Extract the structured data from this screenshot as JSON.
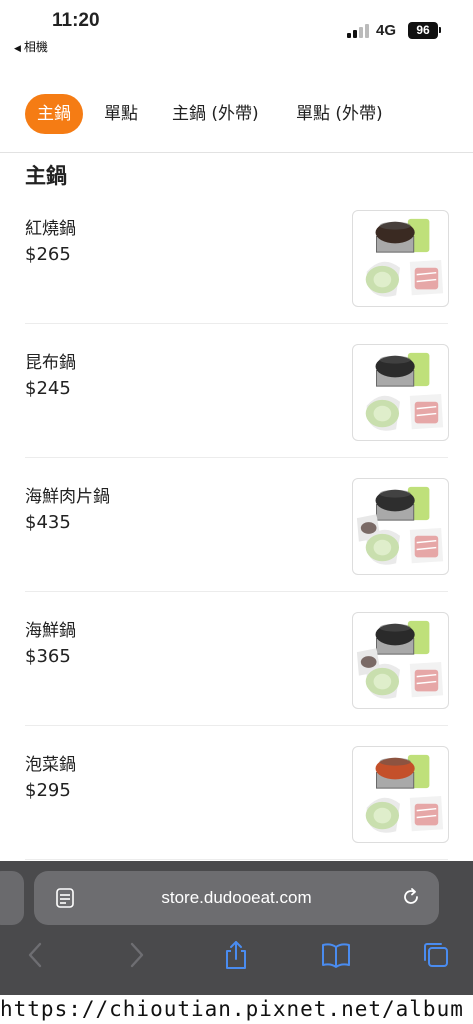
{
  "status_bar": {
    "time": "11:20",
    "back_app": "相機",
    "network": "4G",
    "battery": "96"
  },
  "tabs": [
    {
      "label": "主鍋",
      "active": true
    },
    {
      "label": "單點",
      "active": false
    },
    {
      "label": "主鍋 (外帶)",
      "active": false
    },
    {
      "label": "單點 (外帶)",
      "active": false
    }
  ],
  "section_title": "主鍋",
  "menu_items": [
    {
      "name": "紅燒鍋",
      "price": "$265",
      "broth_color": "#3a2a22"
    },
    {
      "name": "昆布鍋",
      "price": "$245",
      "broth_color": "#2b2b2b"
    },
    {
      "name": "海鮮肉片鍋",
      "price": "$435",
      "broth_color": "#2e2e2e"
    },
    {
      "name": "海鮮鍋",
      "price": "$365",
      "broth_color": "#2a2a2a"
    },
    {
      "name": "泡菜鍋",
      "price": "$295",
      "broth_color": "#c4502a"
    }
  ],
  "browser": {
    "url": "store.dudooeat.com",
    "icons": [
      "reader-icon",
      "reload-icon",
      "back-arrow-icon",
      "forward-arrow-icon",
      "share-icon",
      "bookmarks-icon",
      "tabs-icon"
    ]
  },
  "watermark": "https://chioutian.pixnet.net/album",
  "colors": {
    "accent": "#f57c14",
    "browser_bar": "#4a4a4c",
    "browser_icon": "#4a8cf0"
  }
}
